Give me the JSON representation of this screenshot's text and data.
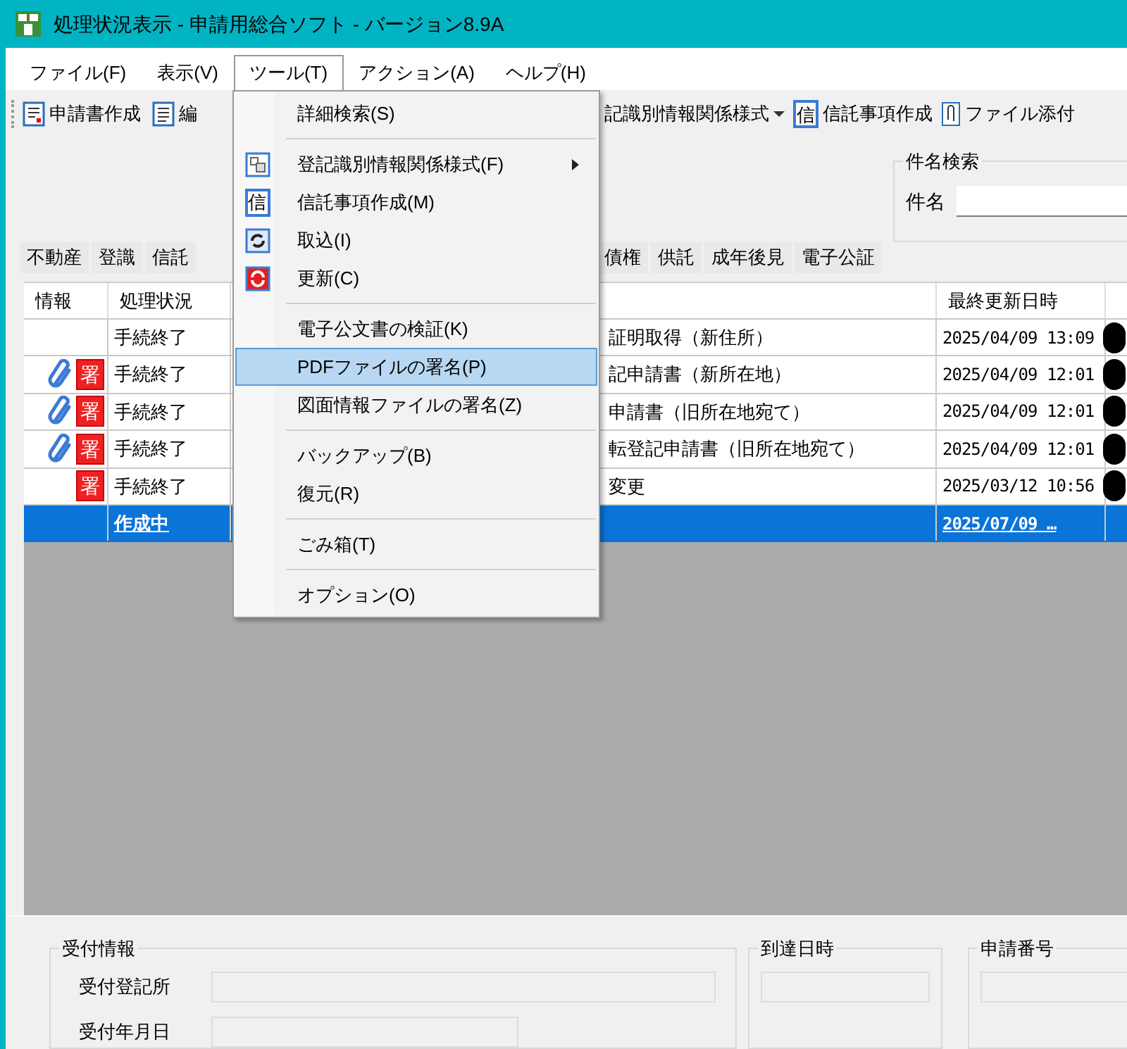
{
  "window": {
    "title": "処理状況表示 - 申請用総合ソフト - バージョン8.9A"
  },
  "menu_bar": [
    {
      "label": "ファイル(F)",
      "selected": false
    },
    {
      "label": "表示(V)",
      "selected": false
    },
    {
      "label": "ツール(T)",
      "selected": true
    },
    {
      "label": "アクション(A)",
      "selected": false
    },
    {
      "label": "ヘルプ(H)",
      "selected": false
    }
  ],
  "toolbar_left": [
    {
      "label": "申請書作成"
    },
    {
      "label": "編"
    }
  ],
  "toolbar_right": [
    {
      "label": "記識別情報関係様式",
      "dropdown": true
    },
    {
      "label": "信託事項作成",
      "icon_text": "信",
      "dropdown": false
    },
    {
      "label": "ファイル添付",
      "dropdown": false
    }
  ],
  "search": {
    "title": "件名検索",
    "label": "件名"
  },
  "tabs_left": [
    {
      "label": "不動産"
    },
    {
      "label": "登識"
    },
    {
      "label": "信託"
    }
  ],
  "tabs_right": [
    {
      "label": "債権"
    },
    {
      "label": "供託"
    },
    {
      "label": "成年後見"
    },
    {
      "label": "電子公証"
    }
  ],
  "table": {
    "columns": [
      "情報",
      "処理状況",
      "最終更新日時"
    ],
    "rows": [
      {
        "attachment": false,
        "badge": null,
        "status": "手続終了",
        "title": "証明取得（新住所）",
        "updated": "2025/04/09 13:09",
        "redacted": true,
        "selected": false
      },
      {
        "attachment": true,
        "badge": "署",
        "status": "手続終了",
        "title": "記申請書（新所在地）",
        "updated": "2025/04/09 12:01",
        "redacted": true,
        "selected": false
      },
      {
        "attachment": true,
        "badge": "署",
        "status": "手続終了",
        "title": "申請書（旧所在地宛て）",
        "updated": "2025/04/09 12:01",
        "redacted": true,
        "selected": false
      },
      {
        "attachment": true,
        "badge": "署",
        "status": "手続終了",
        "title": "転登記申請書（旧所在地宛て）",
        "updated": "2025/04/09 12:01",
        "redacted": true,
        "selected": false
      },
      {
        "attachment": false,
        "badge": "署",
        "status": "手続終了",
        "title": "変更",
        "updated": "2025/03/12 10:56",
        "redacted": true,
        "selected": false
      },
      {
        "attachment": false,
        "badge": null,
        "status": "作成中",
        "title": null,
        "updated": "2025/07/09 …",
        "redacted": false,
        "selected": true
      }
    ]
  },
  "reception": {
    "title": "受付情報",
    "fields": [
      "受付登記所",
      "受付年月日"
    ]
  },
  "arrival": {
    "title": "到達日時"
  },
  "application_number": {
    "title": "申請番号"
  },
  "tools_menu": [
    {
      "kind": "item",
      "label": "詳細検索(S)",
      "submenu": false,
      "selected": false
    },
    {
      "kind": "separator"
    },
    {
      "kind": "item",
      "label": "登記識別情報関係様式(F)",
      "submenu": true,
      "selected": false
    },
    {
      "kind": "item",
      "label": "信託事項作成(M)",
      "icon_text": "信",
      "submenu": false,
      "selected": false
    },
    {
      "kind": "item",
      "label": "取込(I)",
      "submenu": false,
      "selected": false
    },
    {
      "kind": "item",
      "label": "更新(C)",
      "submenu": false,
      "selected": false
    },
    {
      "kind": "separator"
    },
    {
      "kind": "item",
      "label": "電子公文書の検証(K)",
      "submenu": false,
      "selected": false
    },
    {
      "kind": "item",
      "label": "PDFファイルの署名(P)",
      "submenu": false,
      "selected": true
    },
    {
      "kind": "item",
      "label": "図面情報ファイルの署名(Z)",
      "submenu": false,
      "selected": false
    },
    {
      "kind": "separator"
    },
    {
      "kind": "item",
      "label": "バックアップ(B)",
      "submenu": false,
      "selected": false
    },
    {
      "kind": "item",
      "label": "復元(R)",
      "submenu": false,
      "selected": false
    },
    {
      "kind": "separator"
    },
    {
      "kind": "item",
      "label": "ごみ箱(T)",
      "submenu": false,
      "selected": false
    },
    {
      "kind": "separator"
    },
    {
      "kind": "item",
      "label": "オプション(O)",
      "submenu": false,
      "selected": false
    }
  ]
}
